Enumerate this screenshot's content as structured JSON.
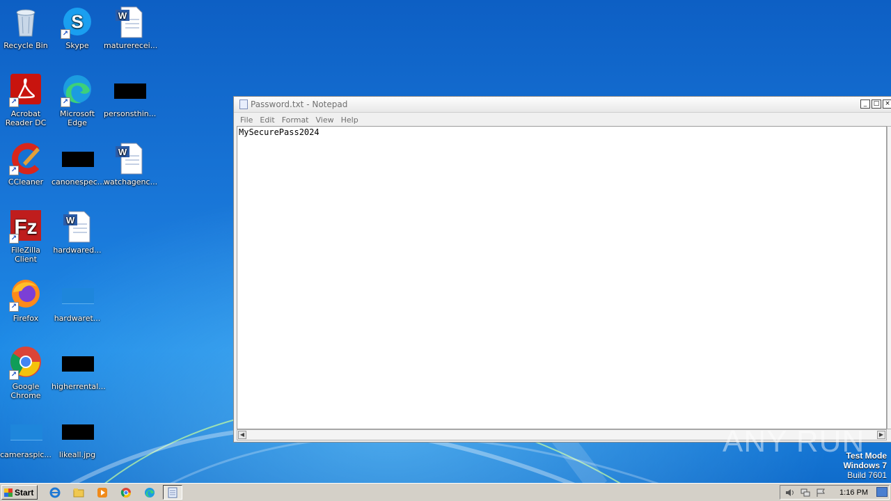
{
  "desktop": {
    "icons": [
      {
        "label": "Recycle Bin"
      },
      {
        "label": "Skype"
      },
      {
        "label": "maturerecei..."
      },
      {
        "label": "Acrobat Reader DC"
      },
      {
        "label": "Microsoft Edge"
      },
      {
        "label": "personsthin..."
      },
      {
        "label": "CCleaner"
      },
      {
        "label": "canonespec..."
      },
      {
        "label": "watchagenc..."
      },
      {
        "label": "FileZilla Client"
      },
      {
        "label": "hardwared..."
      },
      {
        "label": "Firefox"
      },
      {
        "label": "hardwaret..."
      },
      {
        "label": "Google Chrome"
      },
      {
        "label": "higherrental..."
      },
      {
        "label": "cameraspic..."
      },
      {
        "label": "likeall.jpg"
      }
    ]
  },
  "notepad": {
    "title": "Password.txt - Notepad",
    "menu": [
      "File",
      "Edit",
      "Format",
      "View",
      "Help"
    ],
    "content": "MySecurePass2024"
  },
  "watermark": {
    "text": "ANY RUN"
  },
  "test_mode": {
    "line1": "Test Mode",
    "line2": "Windows 7",
    "line3": "Build 7601"
  },
  "taskbar": {
    "start_label": "Start",
    "clock": "1:16 PM"
  }
}
